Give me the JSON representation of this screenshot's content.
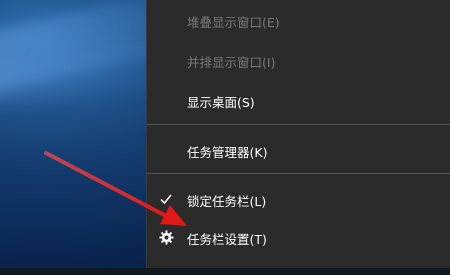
{
  "context_menu": {
    "items": [
      {
        "label": "堆叠显示窗口(E)",
        "enabled": false
      },
      {
        "label": "并排显示窗口(I)",
        "enabled": false
      },
      {
        "label": "显示桌面(S)",
        "enabled": true
      },
      {
        "label": "任务管理器(K)",
        "enabled": true
      },
      {
        "label": "锁定任务栏(L)",
        "enabled": true,
        "checked": true,
        "icon": "check-icon"
      },
      {
        "label": "任务栏设置(T)",
        "enabled": true,
        "icon": "gear-icon"
      }
    ]
  },
  "colors": {
    "menu_background": "#2b2b2b",
    "menu_text": "#ffffff",
    "disabled_text": "#7a7a7a",
    "annotation_arrow": "#e02020"
  }
}
